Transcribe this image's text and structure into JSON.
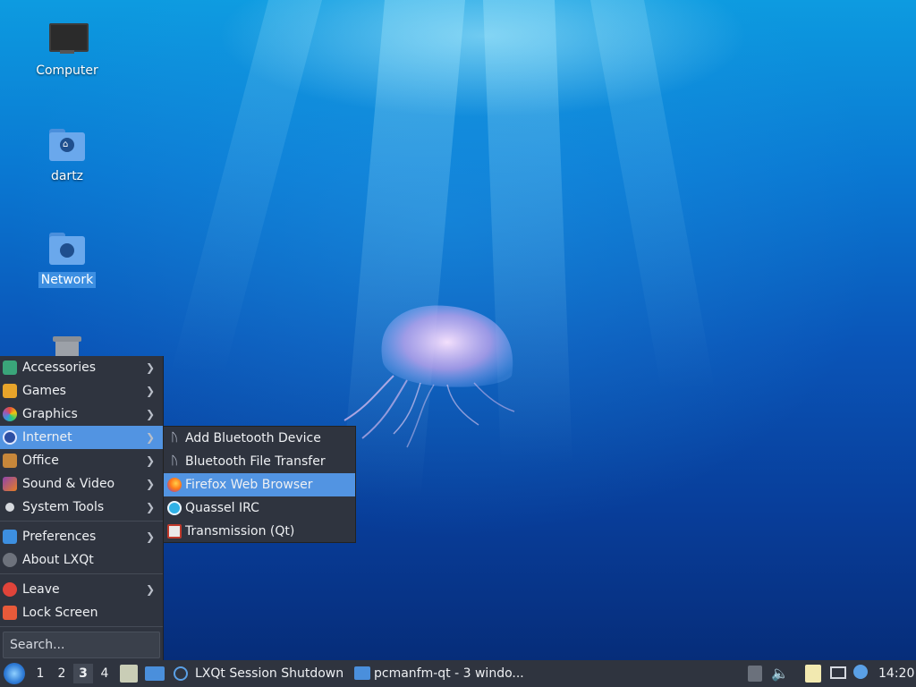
{
  "desktop": {
    "icons": [
      {
        "label": "Computer",
        "icon": "monitor-icon"
      },
      {
        "label": "dartz",
        "icon": "home-folder-icon"
      },
      {
        "label": "Network",
        "icon": "network-folder-icon"
      },
      {
        "label": "",
        "icon": "trash-icon"
      }
    ]
  },
  "menu": {
    "items": [
      {
        "label": "Accessories",
        "icon": "accessories-icon"
      },
      {
        "label": "Games",
        "icon": "games-icon"
      },
      {
        "label": "Graphics",
        "icon": "graphics-icon"
      },
      {
        "label": "Internet",
        "icon": "internet-icon"
      },
      {
        "label": "Office",
        "icon": "office-icon"
      },
      {
        "label": "Sound & Video",
        "icon": "multimedia-icon"
      },
      {
        "label": "System Tools",
        "icon": "system-tools-icon"
      },
      {
        "label": "Preferences",
        "icon": "preferences-icon"
      },
      {
        "label": "About LXQt",
        "icon": "info-icon"
      },
      {
        "label": "Leave",
        "icon": "power-icon"
      },
      {
        "label": "Lock Screen",
        "icon": "lock-icon"
      }
    ],
    "search_placeholder": "Search..."
  },
  "submenu": {
    "items": [
      {
        "label": "Add Bluetooth Device",
        "icon": "bluetooth-icon"
      },
      {
        "label": "Bluetooth File Transfer",
        "icon": "bluetooth-icon"
      },
      {
        "label": "Firefox Web Browser",
        "icon": "firefox-icon"
      },
      {
        "label": "Quassel IRC",
        "icon": "quassel-icon"
      },
      {
        "label": "Transmission (Qt)",
        "icon": "transmission-icon"
      }
    ]
  },
  "taskbar": {
    "desktops": [
      "1",
      "2",
      "3",
      "4"
    ],
    "active_desktop": "3",
    "tasks": [
      {
        "label": "LXQt Session Shutdown",
        "icon": "lxqt-icon"
      },
      {
        "label": "pcmanfm-qt - 3 windo...",
        "icon": "folder-icon"
      }
    ],
    "clock": "14:20"
  },
  "colors": {
    "panel": "#2f343f",
    "highlight": "#5294e2"
  }
}
